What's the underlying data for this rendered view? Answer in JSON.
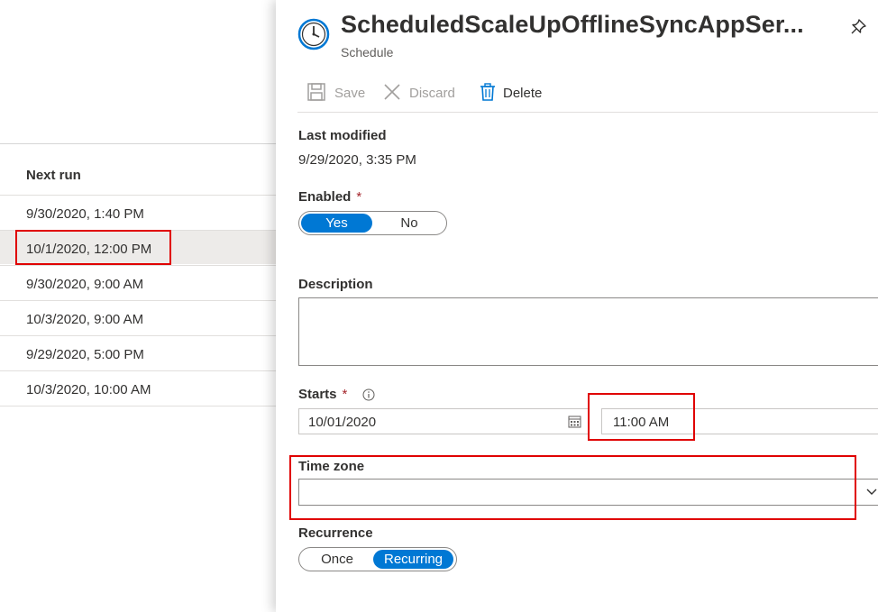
{
  "table": {
    "column_header": "Next run",
    "rows": [
      {
        "next_run": "9/30/2020, 1:40 PM"
      },
      {
        "next_run": "10/1/2020, 12:00 PM"
      },
      {
        "next_run": "9/30/2020, 9:00 AM"
      },
      {
        "next_run": "10/3/2020, 9:00 AM"
      },
      {
        "next_run": "9/29/2020, 5:00 PM"
      },
      {
        "next_run": "10/3/2020, 10:00 AM"
      }
    ]
  },
  "panel": {
    "title": "ScheduledScaleUpOfflineSyncAppSer...",
    "subtitle": "Schedule",
    "icons": {
      "header": "clock-icon",
      "pin": "pin-icon"
    },
    "toolbar": {
      "save_label": "Save",
      "discard_label": "Discard",
      "delete_label": "Delete"
    },
    "last_modified": {
      "label": "Last modified",
      "value": "9/29/2020, 3:35 PM"
    },
    "enabled": {
      "label": "Enabled",
      "required_mark": "*",
      "options": [
        "Yes",
        "No"
      ],
      "selected": "Yes"
    },
    "description": {
      "label": "Description",
      "value": ""
    },
    "starts": {
      "label": "Starts",
      "required_mark": "*",
      "date": "10/01/2020",
      "time": "11:00 AM"
    },
    "time_zone": {
      "label": "Time zone",
      "value": ""
    },
    "recurrence": {
      "label": "Recurrence",
      "options": [
        "Once",
        "Recurring"
      ],
      "selected": "Recurring"
    }
  },
  "colors": {
    "accent": "#0078d4",
    "highlight": "#e00000",
    "selected_row": "#edebe9"
  }
}
